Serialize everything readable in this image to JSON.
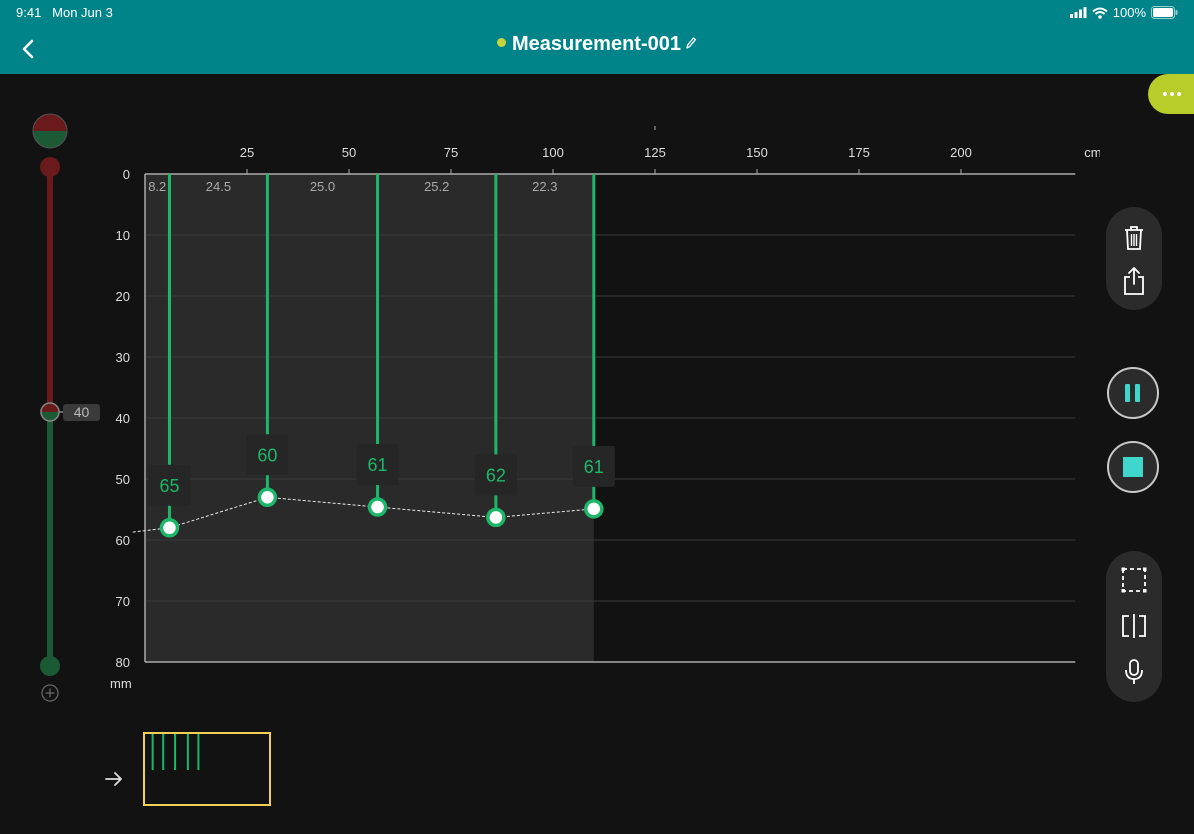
{
  "status_bar": {
    "time": "9:41",
    "date": "Mon Jun 3",
    "battery": "100%"
  },
  "header": {
    "title": "Measurement-001"
  },
  "depth_slider": {
    "value": "40"
  },
  "chart": {
    "x_ticks": [
      "25",
      "50",
      "75",
      "100",
      "125",
      "150",
      "175",
      "200"
    ],
    "x_unit": "cm",
    "y_ticks": [
      "0",
      "10",
      "20",
      "30",
      "40",
      "50",
      "60",
      "70",
      "80"
    ],
    "y_unit": "mm",
    "spacing_labels": [
      "8.2",
      "24.5",
      "25.0",
      "25.2",
      "22.3"
    ],
    "markers": [
      {
        "label": "65",
        "position_cm": 6,
        "depth_mm": 58
      },
      {
        "label": "60",
        "position_cm": 30,
        "depth_mm": 53
      },
      {
        "label": "61",
        "position_cm": 57,
        "depth_mm": 54.6
      },
      {
        "label": "62",
        "position_cm": 86,
        "depth_mm": 56.3
      },
      {
        "label": "61",
        "position_cm": 110,
        "depth_mm": 54.9
      }
    ]
  },
  "colors": {
    "accent": "#008489",
    "marker": "#1db76a",
    "more": "#b8cc2a",
    "minimap_border": "#f2cf55"
  },
  "icons": [
    "back-icon",
    "edit-icon",
    "more-icon",
    "trash-icon",
    "share-icon",
    "pause-icon",
    "stop-icon",
    "select-area-icon",
    "split-icon",
    "microphone-icon",
    "add-icon",
    "arrow-right-icon"
  ]
}
